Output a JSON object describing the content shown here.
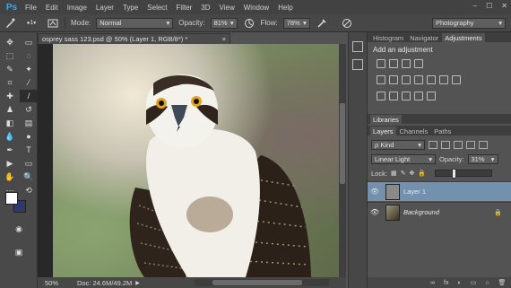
{
  "app": {
    "logo": "Ps"
  },
  "menu": [
    "File",
    "Edit",
    "Image",
    "Layer",
    "Type",
    "Select",
    "Filter",
    "3D",
    "View",
    "Window",
    "Help"
  ],
  "window_controls": [
    "–",
    "☐",
    "✕"
  ],
  "options": {
    "brush_size": "1",
    "mode_label": "Mode:",
    "mode_value": "Normal",
    "opacity_label": "Opacity:",
    "opacity_value": "81%",
    "flow_label": "Flow:",
    "flow_value": "78%",
    "workspace": "Photography"
  },
  "document": {
    "tab_title": "osprey sass 123.psd @ 50% (Layer 1, RGB/8*) *",
    "close_glyph": "×",
    "zoom": "50%",
    "doc_size": "Doc: 24.6M/49.2M",
    "status_arrow": "▶"
  },
  "adjustments_panel": {
    "tabs": [
      "Histogram",
      "Navigator",
      "Adjustments"
    ],
    "active_tab": "Adjustments",
    "title": "Add an adjustment"
  },
  "libraries_panel": {
    "tabs": [
      "Libraries"
    ]
  },
  "layers_panel": {
    "tabs": [
      "Layers",
      "Channels",
      "Paths"
    ],
    "active_tab": "Layers",
    "filter_label": "ρ Kind",
    "blend_mode": "Linear Light",
    "opacity_label": "Opacity:",
    "opacity_value": "31%",
    "lock_label": "Lock:",
    "fill_value": "",
    "layers": [
      {
        "name": "Layer 1",
        "selected": true
      },
      {
        "name": "Background",
        "selected": false,
        "locked": true
      }
    ],
    "bottom_icons": [
      "∞",
      "fx",
      "◐",
      "▭",
      "⌂",
      "🗑"
    ]
  },
  "colors": {
    "accent": "#7390ad",
    "foreground_swatch": "#ffffff",
    "background_swatch": "#2f3a6a",
    "logo": "#4aa3e0"
  }
}
